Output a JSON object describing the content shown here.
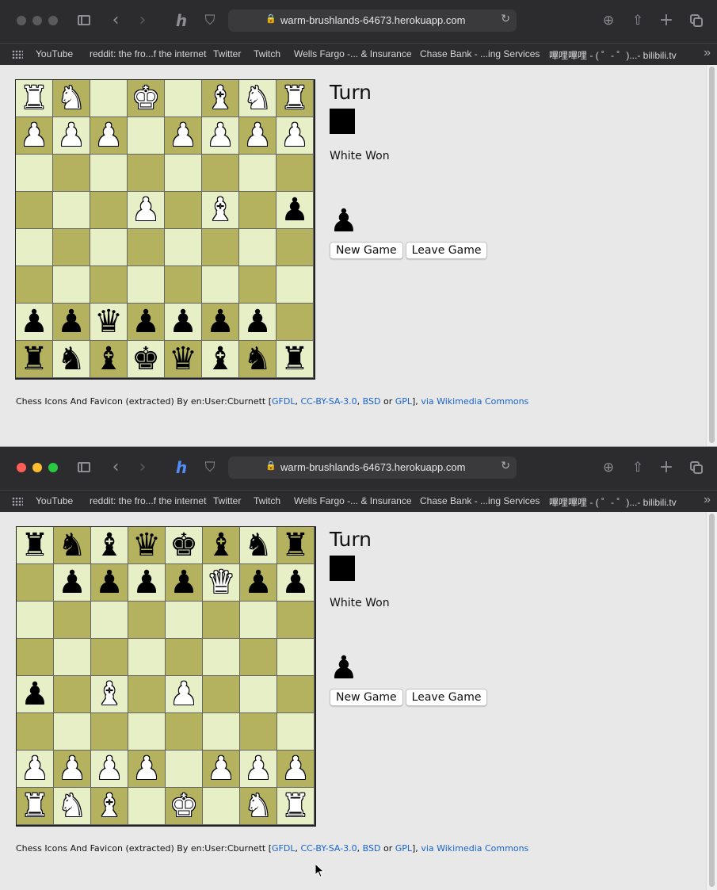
{
  "windows": [
    {
      "active": false,
      "url": "warm-brushlands-64673.herokuapp.com",
      "bookmarks": [
        "YouTube",
        "reddit: the fro...f the internet",
        "Twitter",
        "Twitch",
        "Wells Fargo -... & Insurance",
        "Chase Bank - ...ing Services",
        "嗶哩嗶哩 - ( ゜- ゜)...- bilibili.tv"
      ],
      "board": [
        [
          "wR",
          "wN",
          "",
          "wK",
          "",
          "wB",
          "wN",
          "wR"
        ],
        [
          "wP",
          "wP",
          "wP",
          "",
          "wP",
          "wP",
          "wP",
          "wP"
        ],
        [
          "",
          "",
          "",
          "",
          "",
          "",
          "",
          ""
        ],
        [
          "",
          "",
          "",
          "wP",
          "",
          "wB",
          "",
          "bP"
        ],
        [
          "",
          "",
          "",
          "",
          "",
          "",
          "",
          ""
        ],
        [
          "",
          "",
          "",
          "",
          "",
          "",
          "",
          ""
        ],
        [
          "bP",
          "bP",
          "bQ",
          "bP",
          "bP",
          "bP",
          "bP",
          ""
        ],
        [
          "bR",
          "bN",
          "bB",
          "bK",
          "bQ",
          "bB",
          "bN",
          "bR"
        ]
      ],
      "turn_label": "Turn",
      "turn_color": "#000000",
      "status": "White Won",
      "player_piece": "bP",
      "new_game_label": "New Game",
      "leave_game_label": "Leave Game"
    },
    {
      "active": true,
      "url": "warm-brushlands-64673.herokuapp.com",
      "bookmarks": [
        "YouTube",
        "reddit: the fro...f the internet",
        "Twitter",
        "Twitch",
        "Wells Fargo -... & Insurance",
        "Chase Bank - ...ing Services",
        "嗶哩嗶哩 - ( ゜- ゜)...- bilibili.tv"
      ],
      "board": [
        [
          "bR",
          "bN",
          "bB",
          "bQ",
          "bK",
          "bB",
          "bN",
          "bR"
        ],
        [
          "",
          "bP",
          "bP",
          "bP",
          "bP",
          "wQ",
          "bP",
          "bP"
        ],
        [
          "",
          "",
          "",
          "",
          "",
          "",
          "",
          ""
        ],
        [
          "",
          "",
          "",
          "",
          "",
          "",
          "",
          ""
        ],
        [
          "bP",
          "",
          "wB",
          "",
          "wP",
          "",
          "",
          ""
        ],
        [
          "",
          "",
          "",
          "",
          "",
          "",
          "",
          ""
        ],
        [
          "wP",
          "wP",
          "wP",
          "wP",
          "",
          "wP",
          "wP",
          "wP"
        ],
        [
          "wR",
          "wN",
          "wB",
          "",
          "wK",
          "",
          "wN",
          "wR"
        ]
      ],
      "turn_label": "Turn",
      "turn_color": "#000000",
      "status": "White Won",
      "player_piece": "bP",
      "new_game_label": "New Game",
      "leave_game_label": "Leave Game"
    }
  ],
  "credits": {
    "prefix": "Chess Icons And Favicon (extracted) By en:User:Cburnett [",
    "links": [
      "GFDL",
      "CC-BY-SA-3.0",
      "BSD",
      "GPL"
    ],
    "separators": [
      ", ",
      ", ",
      " or ",
      "], "
    ],
    "commons_link": "via Wikimedia Commons"
  },
  "piece_glyphs": {
    "K": "♚",
    "Q": "♛",
    "R": "♜",
    "B": "♝",
    "N": "♞",
    "P": "♟"
  }
}
